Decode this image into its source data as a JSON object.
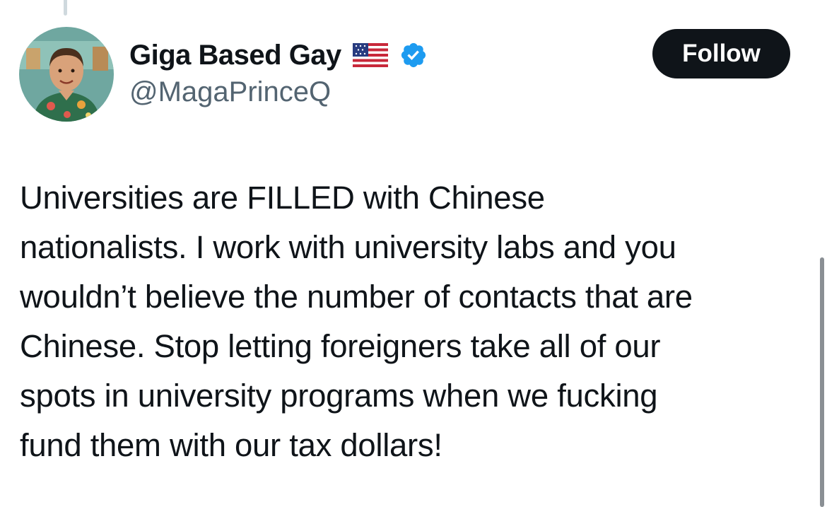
{
  "author": {
    "display_name": "Giga Based Gay",
    "handle": "@MagaPrinceQ",
    "flag_icon": "us-flag-icon",
    "verified_icon": "verified-badge-icon",
    "verified_color": "#1d9bf0"
  },
  "actions": {
    "follow_label": "Follow"
  },
  "tweet": {
    "text": "Universities are FILLED with Chinese\nnationalists. I work with university labs and you\nwouldn’t believe the number of contacts that are\nChinese. Stop letting foreigners take all of our\nspots in university programs when we fucking\nfund them with our tax dollars!"
  }
}
